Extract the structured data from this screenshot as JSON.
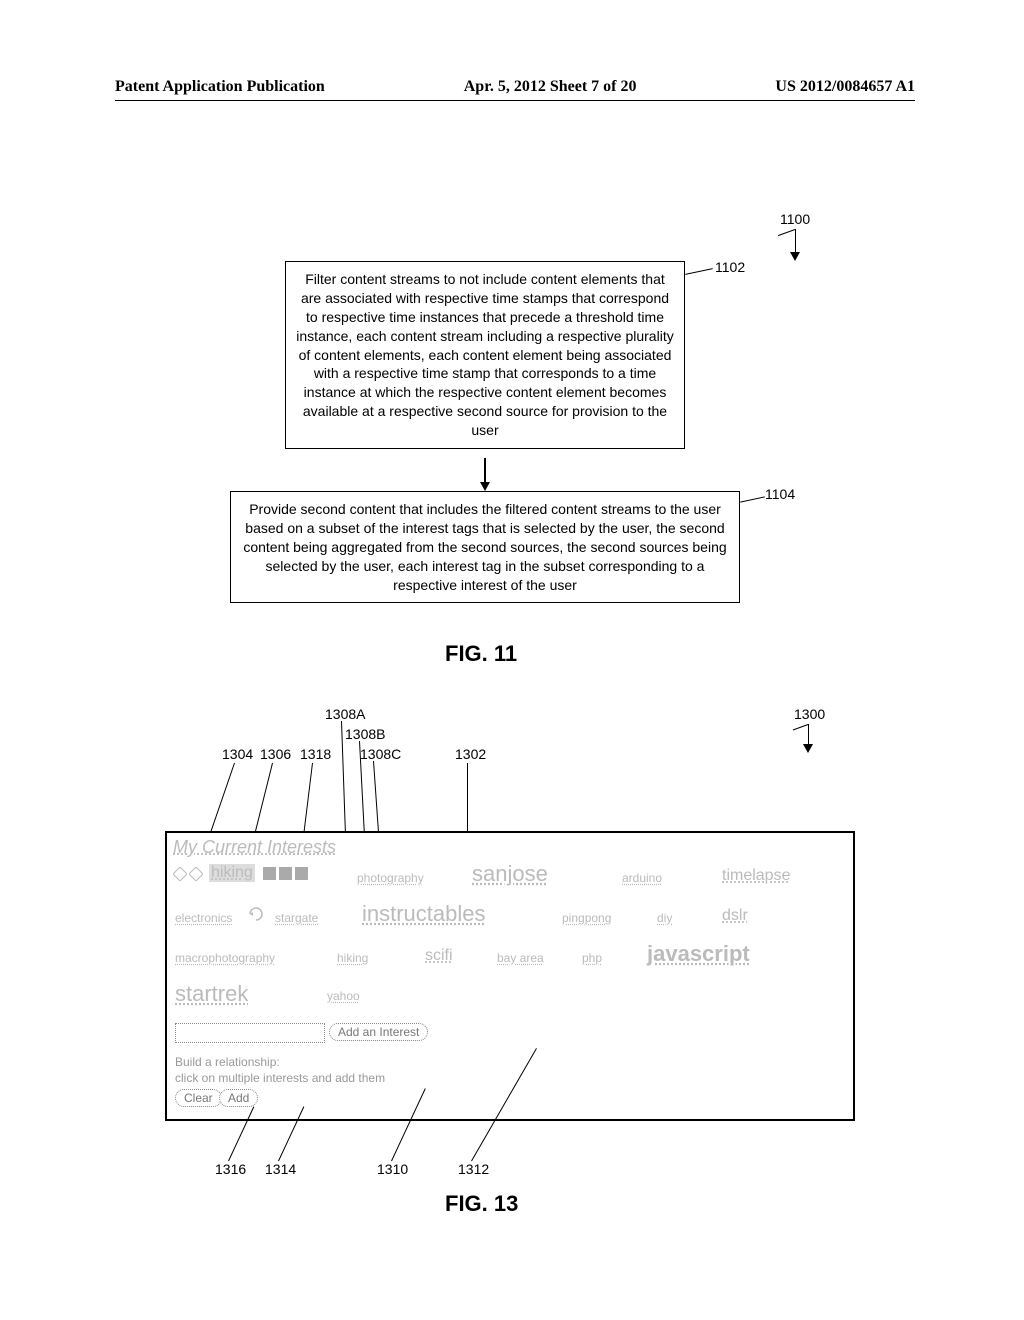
{
  "header": {
    "left": "Patent Application Publication",
    "mid": "Apr. 5, 2012  Sheet 7 of 20",
    "right": "US 2012/0084657 A1"
  },
  "flowchart": {
    "ref_1100": "1100",
    "ref_1102": "1102",
    "ref_1104": "1104",
    "box1": "Filter content streams to not include content elements that are associated with respective time stamps that correspond to respective time instances that precede a threshold time instance, each content stream including a respective plurality of content elements, each content element being associated with a respective time stamp that corresponds to a time instance at which the respective content element becomes available at a respective second source for provision to the user",
    "box2": "Provide second content that includes the filtered content streams to the user based on a subset of the interest tags that is selected by the user, the second content being aggregated from the second sources, the second sources being selected by the user, each interest tag in the subset corresponding to a respective interest of the user",
    "fig11": "FIG. 11"
  },
  "fig13": {
    "label": "FIG. 13",
    "refs": {
      "r1304": "1304",
      "r1306": "1306",
      "r1318": "1318",
      "r1308A": "1308A",
      "r1308B": "1308B",
      "r1308C": "1308C",
      "r1302": "1302",
      "r1300": "1300",
      "r1310": "1310",
      "r1312": "1312",
      "r1314": "1314",
      "r1316": "1316"
    },
    "panel": {
      "title": "My Current Interests",
      "add_interest_btn": "Add an Interest",
      "helper1": "Build a relationship:",
      "helper2": "click on multiple interests and add them",
      "clear_btn": "Clear",
      "add_btn": "Add",
      "tags": {
        "hiking_sel": "hiking",
        "photography": "photography",
        "sanjose": "sanjose",
        "arduino": "arduino",
        "timelapse": "timelapse",
        "electronics": "electronics",
        "stargate": "stargate",
        "instructables": "instructables",
        "pingpong": "pingpong",
        "diy": "diy",
        "dslr": "dslr",
        "macrophotography": "macrophotography",
        "hiking2": "hiking",
        "scifi": "scifi",
        "bayarea": "bay area",
        "php": "php",
        "javascript": "javascript",
        "startrek": "startrek",
        "yahoo": "yahoo"
      }
    }
  }
}
